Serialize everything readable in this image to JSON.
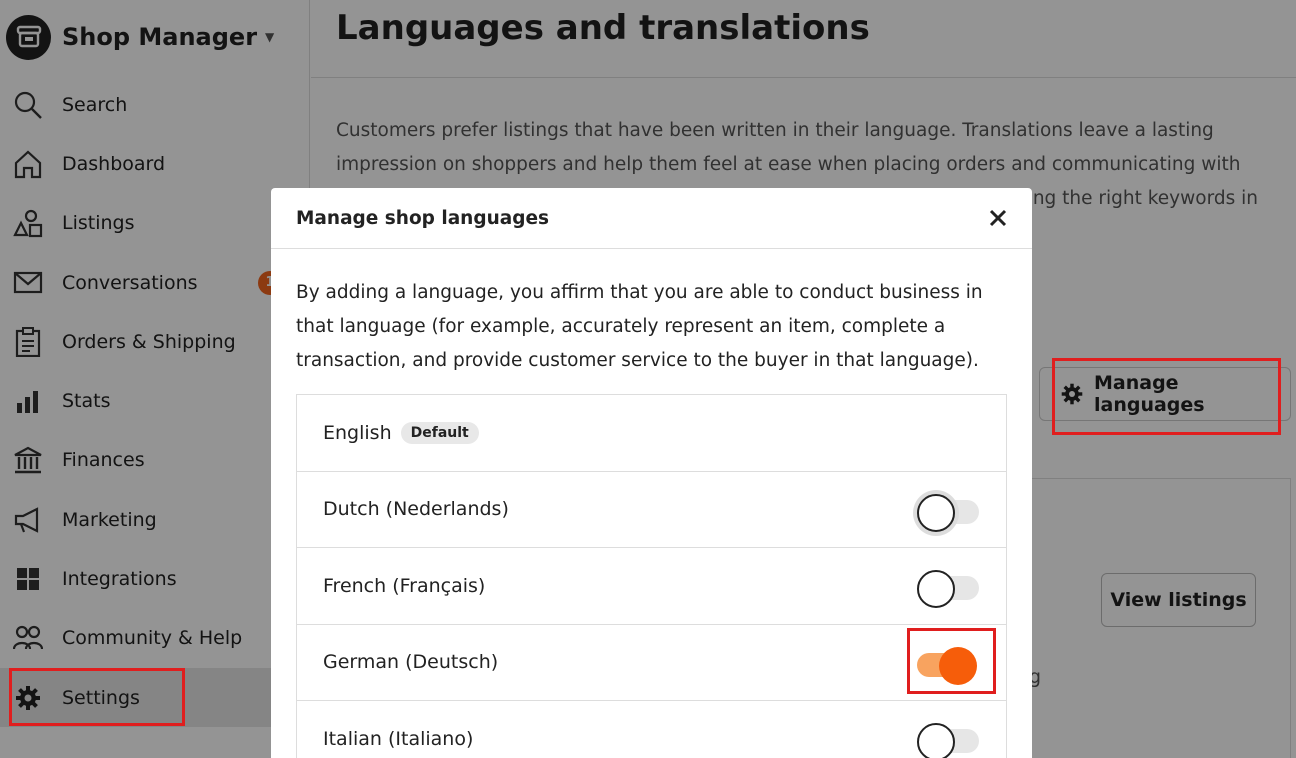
{
  "sidebar": {
    "brand_title": "Shop Manager",
    "nav": [
      {
        "label": "Search",
        "icon": "search-icon"
      },
      {
        "label": "Dashboard",
        "icon": "home-icon"
      },
      {
        "label": "Listings",
        "icon": "shapes-icon"
      },
      {
        "label": "Conversations",
        "icon": "envelope-icon",
        "badge": "1"
      },
      {
        "label": "Orders & Shipping",
        "icon": "clipboard-icon"
      },
      {
        "label": "Stats",
        "icon": "bar-chart-icon"
      },
      {
        "label": "Finances",
        "icon": "bank-icon"
      },
      {
        "label": "Marketing",
        "icon": "megaphone-icon"
      },
      {
        "label": "Integrations",
        "icon": "grid-icon"
      },
      {
        "label": "Community & Help",
        "icon": "people-icon"
      },
      {
        "label": "Settings",
        "icon": "gear-icon",
        "active": true
      }
    ]
  },
  "main": {
    "title": "Languages and translations",
    "intro_line1": "Customers prefer listings that have been written in their language. Translations leave a lasting",
    "intro_line2": "impression on shoppers and help them feel at ease when placing orders and communicating with",
    "intro_line3": "ng the right keywords in",
    "manage_languages_label": "Manage languages",
    "view_listings_label": "View listings",
    "stray_text": "g"
  },
  "modal": {
    "title": "Manage shop languages",
    "description": "By adding a language, you affirm that you are able to conduct business in that language (for example, accurately represent an item, complete a transaction, and provide customer service to the buyer in that language).",
    "default_badge": "Default",
    "languages": [
      {
        "name": "English",
        "default": true
      },
      {
        "name": "Dutch (Nederlands)",
        "enabled": false
      },
      {
        "name": "French (Français)",
        "enabled": false
      },
      {
        "name": "German (Deutsch)",
        "enabled": true
      },
      {
        "name": "Italian (Italiano)",
        "enabled": false
      }
    ]
  },
  "colors": {
    "accent_orange": "#f65d0a",
    "toggle_track_on": "#f8a35f",
    "badge_orange": "#f1641e",
    "highlight_red": "#e01e1e"
  }
}
